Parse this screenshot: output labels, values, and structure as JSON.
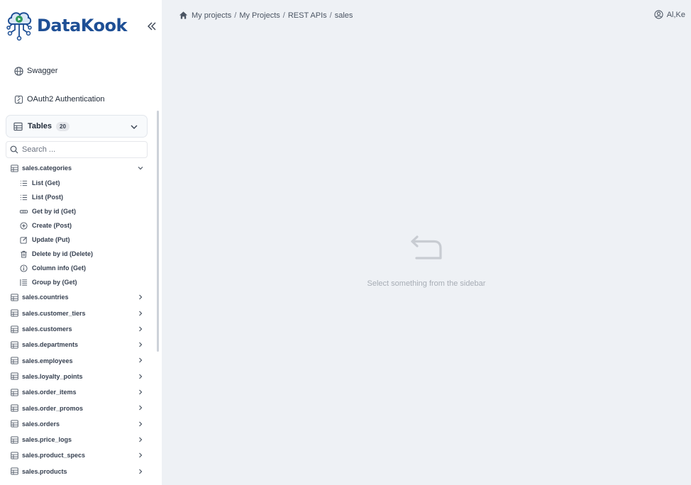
{
  "brand": {
    "name": "DataKook"
  },
  "nav": {
    "swagger": "Swagger",
    "oauth": "OAuth2 Authentication"
  },
  "tables": {
    "label": "Tables",
    "count": "20",
    "search_placeholder": "Search ...",
    "expanded": {
      "name": "sales.categories",
      "endpoints": [
        {
          "label": "List (Get)",
          "icon": "list-icon"
        },
        {
          "label": "List (Post)",
          "icon": "list-icon"
        },
        {
          "label": "Get by id (Get)",
          "icon": "key-icon"
        },
        {
          "label": "Create (Post)",
          "icon": "plus-circle-icon"
        },
        {
          "label": "Update (Put)",
          "icon": "edit-icon"
        },
        {
          "label": "Delete by id (Delete)",
          "icon": "trash-icon"
        },
        {
          "label": "Column info (Get)",
          "icon": "info-icon"
        },
        {
          "label": "Group by (Get)",
          "icon": "group-icon"
        }
      ]
    },
    "items": [
      "sales.countries",
      "sales.customer_tiers",
      "sales.customers",
      "sales.departments",
      "sales.employees",
      "sales.loyalty_points",
      "sales.order_items",
      "sales.order_promos",
      "sales.orders",
      "sales.price_logs",
      "sales.product_specs",
      "sales.products"
    ]
  },
  "breadcrumb": [
    "My projects",
    "My Projects",
    "REST APIs",
    "sales"
  ],
  "user": {
    "name": "Al,Ke"
  },
  "empty_state": {
    "message": "Select something from the sidebar"
  },
  "colors": {
    "brand": "#1e4f95",
    "main_bg": "#eef1f5",
    "logo_green": "#2f9a5a"
  }
}
